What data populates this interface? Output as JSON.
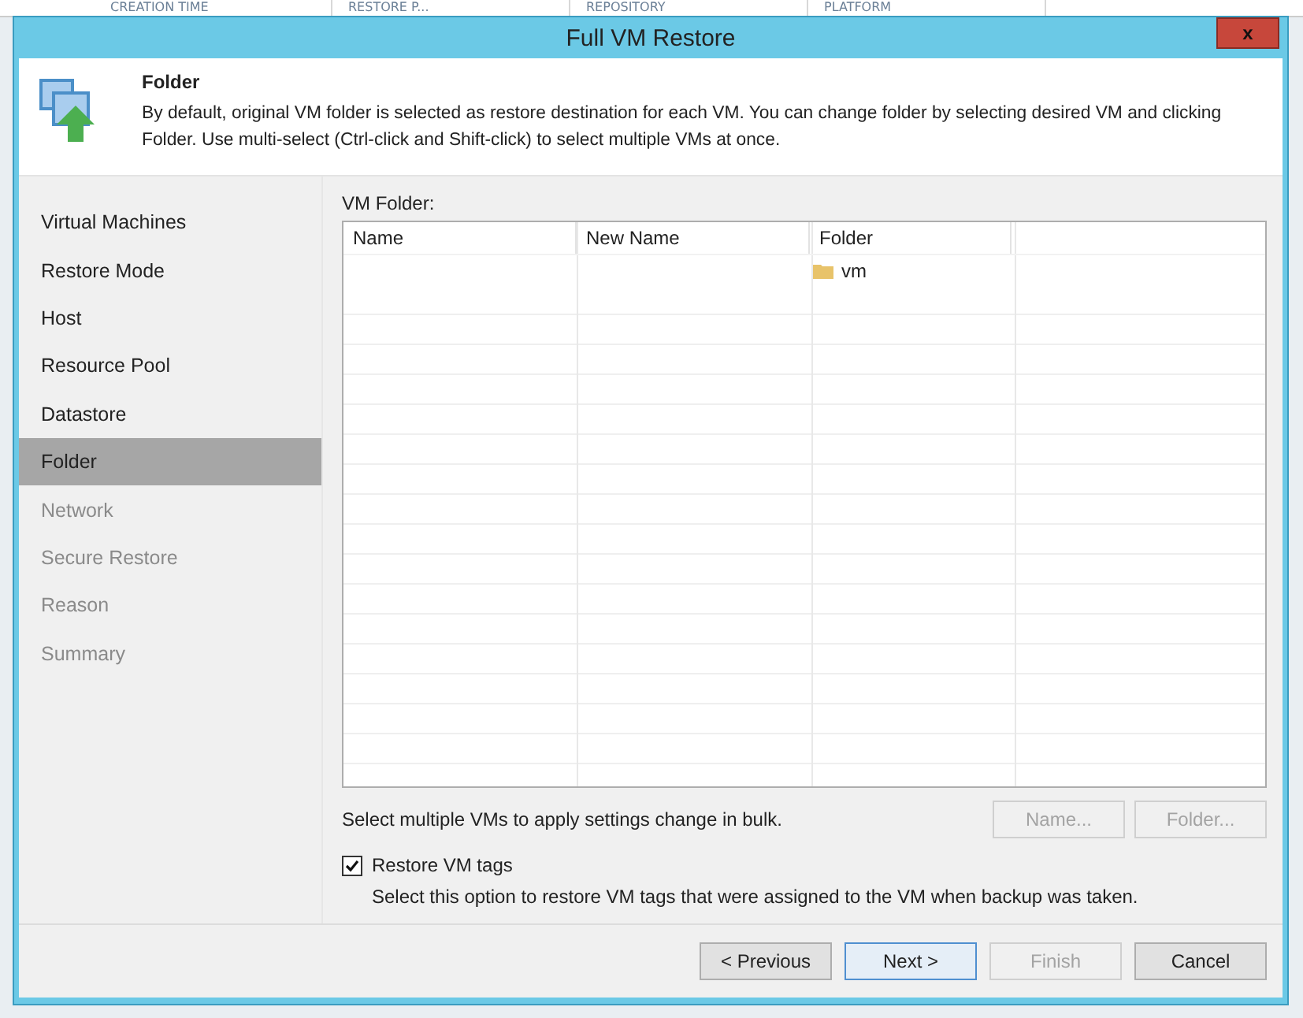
{
  "background_window": {
    "columns": [
      "CREATION TIME",
      "RESTORE P...",
      "REPOSITORY",
      "PLATFORM"
    ]
  },
  "window": {
    "title": "Full VM Restore",
    "close": "x"
  },
  "header": {
    "title": "Folder",
    "description": "By default, original VM folder is selected as restore destination for each VM. You can change folder by selecting desired VM and clicking Folder. Use multi-select (Ctrl-click and Shift-click) to select multiple VMs at once."
  },
  "sidebar": {
    "items": [
      {
        "label": "Virtual Machines",
        "selected": false,
        "disabled": false
      },
      {
        "label": "Restore Mode",
        "selected": false,
        "disabled": false
      },
      {
        "label": "Host",
        "selected": false,
        "disabled": false
      },
      {
        "label": "Resource Pool",
        "selected": false,
        "disabled": false
      },
      {
        "label": "Datastore",
        "selected": false,
        "disabled": false
      },
      {
        "label": "Folder",
        "selected": true,
        "disabled": false
      },
      {
        "label": "Network",
        "selected": false,
        "disabled": true
      },
      {
        "label": "Secure Restore",
        "selected": false,
        "disabled": true
      },
      {
        "label": "Reason",
        "selected": false,
        "disabled": true
      },
      {
        "label": "Summary",
        "selected": false,
        "disabled": true
      }
    ]
  },
  "table": {
    "label": "VM Folder:",
    "columns": [
      "Name",
      "New Name",
      "Folder"
    ],
    "rows": [
      {
        "folder": "vm"
      }
    ]
  },
  "bulk_hint": "Select multiple VMs to apply settings change in bulk.",
  "table_buttons": [
    {
      "label": "Name...",
      "disabled": true
    },
    {
      "label": "Folder...",
      "disabled": true
    }
  ],
  "options": [
    {
      "label": "Restore VM tags",
      "checked": true,
      "description": "Select this option to restore VM tags that were assigned to the VM when backup was taken."
    }
  ],
  "buttons": [
    {
      "label": "< Previous",
      "disabled": false,
      "default": false
    },
    {
      "label": "Next >",
      "disabled": false,
      "default": true
    },
    {
      "label": "Finish",
      "disabled": true,
      "default": false
    },
    {
      "label": "Cancel",
      "disabled": false,
      "default": false
    }
  ]
}
